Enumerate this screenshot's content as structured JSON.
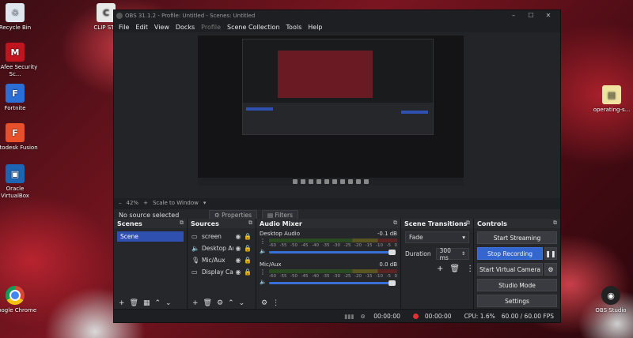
{
  "desktop": {
    "icons": [
      {
        "label": "Recycle Bin",
        "icon": "recycle-bin-icon"
      },
      {
        "label": "McAfee Security Sc...",
        "icon": "mcafee-icon"
      },
      {
        "label": "Fortnite",
        "icon": "fortnite-icon"
      },
      {
        "label": "Autodesk Fusion",
        "icon": "fusion-icon"
      },
      {
        "label": "Oracle VirtualBox",
        "icon": "virtualbox-icon"
      },
      {
        "label": "Google Chrome",
        "icon": "chrome-icon"
      },
      {
        "label": "CLIP STU",
        "icon": "clip-studio-icon"
      },
      {
        "label": "operating-s...",
        "icon": "folder-file-icon"
      },
      {
        "label": "OBS Studio",
        "icon": "obs-icon"
      }
    ]
  },
  "window": {
    "title": "OBS 31.1.2 - Profile: Untitled - Scenes: Untitled",
    "controls": [
      "–",
      "☐",
      "✕"
    ]
  },
  "menu": [
    "File",
    "Edit",
    "View",
    "Docks",
    "Profile",
    "Scene Collection",
    "Tools",
    "Help"
  ],
  "zoom": {
    "value": "42%",
    "label": "Scale to Window"
  },
  "source_bar": {
    "no_source": "No source selected",
    "properties": "Properties",
    "filters": "Filters"
  },
  "scenes": {
    "title": "Scenes",
    "items": [
      "Scene"
    ]
  },
  "sources": {
    "title": "Sources",
    "items": [
      "screen",
      "Desktop Au",
      "Mic/Aux",
      "Display Cap"
    ]
  },
  "mixer": {
    "title": "Audio Mixer",
    "channels": [
      {
        "name": "Desktop Audio",
        "db": "-0.1 dB"
      },
      {
        "name": "Mic/Aux",
        "db": "0.0 dB"
      }
    ],
    "scale": [
      "-60",
      "-55",
      "-50",
      "-45",
      "-40",
      "-35",
      "-30",
      "-25",
      "-20",
      "-15",
      "-10",
      "-5",
      "0"
    ]
  },
  "transitions": {
    "title": "Scene Transitions",
    "type": "Fade",
    "duration_label": "Duration",
    "duration": "300 ms"
  },
  "controls": {
    "title": "Controls",
    "start_streaming": "Start Streaming",
    "stop_recording": "Stop Recording",
    "start_virtual_camera": "Start Virtual Camera",
    "studio_mode": "Studio Mode",
    "settings": "Settings"
  },
  "status": {
    "stream_time": "00:00:00",
    "rec_time": "00:00:00",
    "cpu": "CPU: 1.6%",
    "fps": "60.00 / 60.00 FPS"
  },
  "colors": {
    "accent": "#3466d0",
    "record": "#e03030",
    "panel": "#26272b"
  }
}
